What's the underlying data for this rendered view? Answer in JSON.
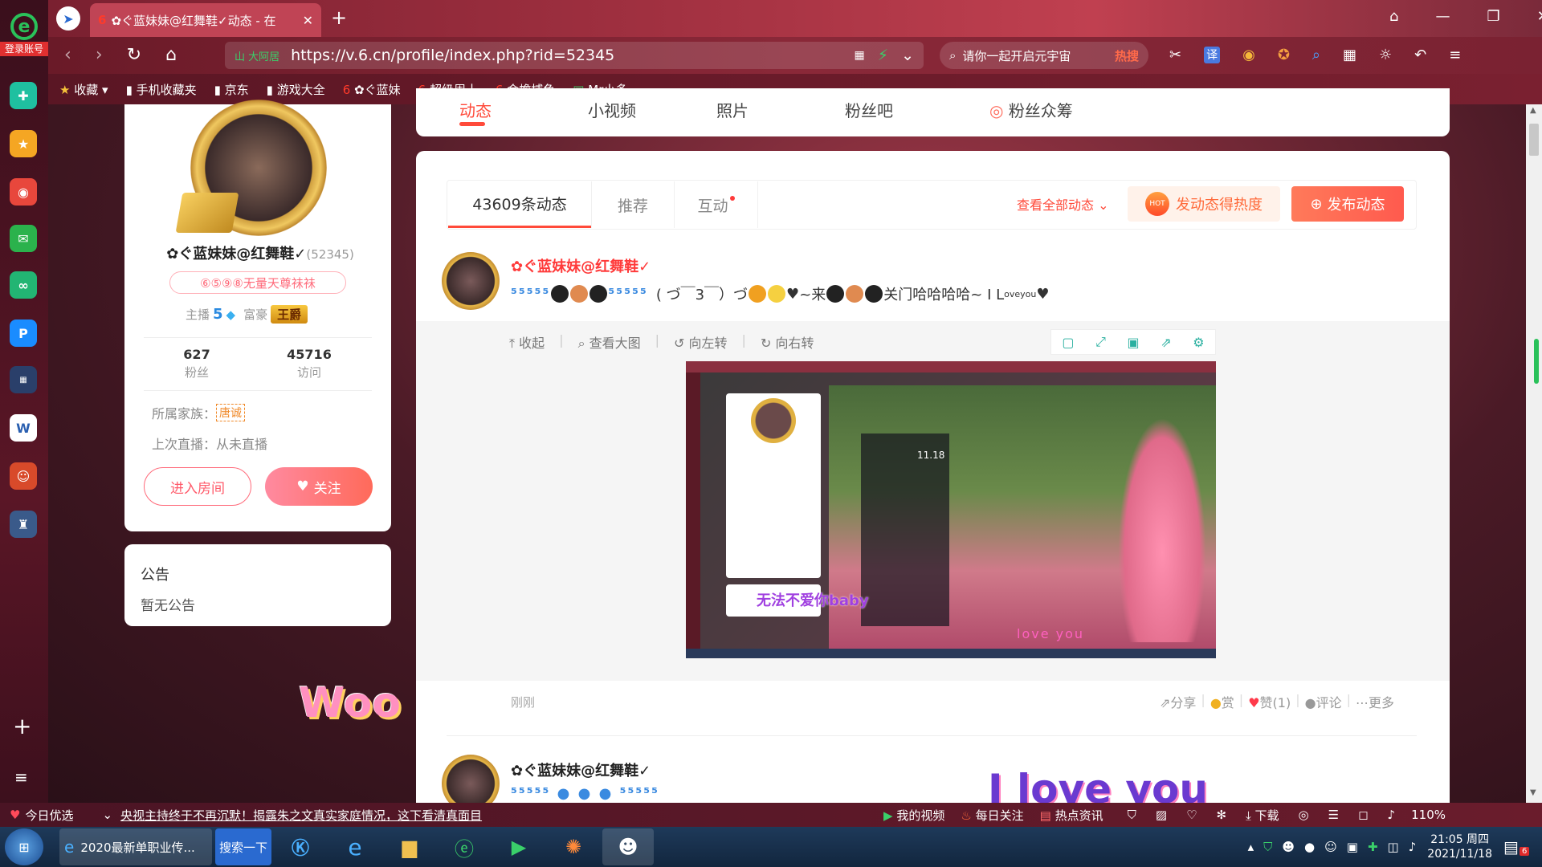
{
  "browser": {
    "login_label": "登录账号",
    "tab_title": "✿ぐ蓝妹妹@红舞鞋✓动态 - 在",
    "address_prefix": "山 大阿居",
    "url": "https://v.6.cn/profile/index.php?rid=52345",
    "search_placeholder": "请你一起开启元宇宙",
    "search_hot": "热搜",
    "bookmarks": [
      "收藏",
      "手机收藏夹",
      "京东",
      "游戏大全",
      "✿ぐ蓝妹",
      "超级周十",
      "金蟾捕鱼",
      "Mr小多"
    ]
  },
  "profile_nav": [
    "动态",
    "小视频",
    "照片",
    "粉丝吧",
    "粉丝众筹"
  ],
  "profile": {
    "name": "✿ぐ蓝妹妹@红舞鞋✓",
    "rid": "(52345)",
    "badge_text": "⑥⑤⑨⑧无量天尊祙祙",
    "anchor_label": "主播",
    "anchor_level": "5",
    "rich_label": "富豪",
    "rich_level": "王爵",
    "fans_count": "627",
    "fans_label": "粉丝",
    "visits_count": "45716",
    "visits_label": "访问",
    "family_label": "所属家族：",
    "family_value": "唐诚",
    "last_live": "上次直播：从未直播",
    "enter_room": "进入房间",
    "follow": "关注"
  },
  "notice": {
    "title": "公告",
    "body": "暂无公告"
  },
  "deco_woo": "Woo",
  "feed": {
    "tabs": [
      "43609条动态",
      "推荐",
      "互动"
    ],
    "view_all": "查看全部动态",
    "hot_btn": "发动态得热度",
    "post_btn": "发布动态",
    "post": {
      "name": "✿ぐ蓝妹妹@红舞鞋✓",
      "text_a": "( づ￣3￣）づ",
      "text_b": "~来",
      "text_c": "关门哈哈哈哈~ I  L",
      "text_love_sup": "ove",
      "text_you_sub": "you",
      "tools": [
        "收起",
        "查看大图",
        "向左转",
        "向右转"
      ],
      "time": "刚刚",
      "actions": [
        "分享",
        "赏",
        "赞(1)",
        "评论",
        "更多"
      ]
    },
    "post2_name": "✿ぐ蓝妹妹@红舞鞋✓"
  },
  "embedded": {
    "date": "11.18",
    "lyric_cn": "无法不爱你baby",
    "lyric_en": "love  you",
    "deco_big": "I  love  you"
  },
  "status": {
    "today": "今日优选",
    "news": "央视主持终于不再沉默！揭露朱之文真实家庭情况，这下看清真面目",
    "my_video": "我的视频",
    "daily": "每日关注",
    "hot_news": "热点资讯",
    "download": "下载",
    "zoom": "110%"
  },
  "taskbar": {
    "ie_item": "2020最新单职业传...",
    "search_btn": "搜索一下",
    "time": "21:05 周四",
    "date": "2021/11/18",
    "badge": "6"
  },
  "colors": {
    "accent": "#ff5a4e",
    "pink": "#ff7a9a",
    "dark_bg": "#5a1a2a"
  }
}
